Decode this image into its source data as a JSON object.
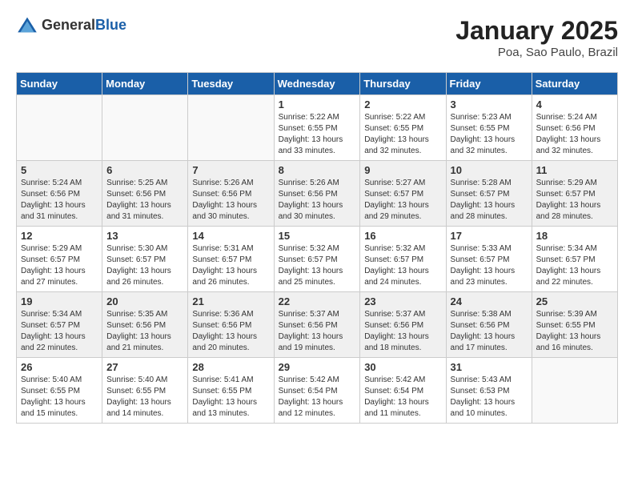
{
  "header": {
    "logo_general": "General",
    "logo_blue": "Blue",
    "month_title": "January 2025",
    "location": "Poa, Sao Paulo, Brazil"
  },
  "weekdays": [
    "Sunday",
    "Monday",
    "Tuesday",
    "Wednesday",
    "Thursday",
    "Friday",
    "Saturday"
  ],
  "weeks": [
    [
      {
        "day": "",
        "info": ""
      },
      {
        "day": "",
        "info": ""
      },
      {
        "day": "",
        "info": ""
      },
      {
        "day": "1",
        "info": "Sunrise: 5:22 AM\nSunset: 6:55 PM\nDaylight: 13 hours\nand 33 minutes."
      },
      {
        "day": "2",
        "info": "Sunrise: 5:22 AM\nSunset: 6:55 PM\nDaylight: 13 hours\nand 32 minutes."
      },
      {
        "day": "3",
        "info": "Sunrise: 5:23 AM\nSunset: 6:55 PM\nDaylight: 13 hours\nand 32 minutes."
      },
      {
        "day": "4",
        "info": "Sunrise: 5:24 AM\nSunset: 6:56 PM\nDaylight: 13 hours\nand 32 minutes."
      }
    ],
    [
      {
        "day": "5",
        "info": "Sunrise: 5:24 AM\nSunset: 6:56 PM\nDaylight: 13 hours\nand 31 minutes."
      },
      {
        "day": "6",
        "info": "Sunrise: 5:25 AM\nSunset: 6:56 PM\nDaylight: 13 hours\nand 31 minutes."
      },
      {
        "day": "7",
        "info": "Sunrise: 5:26 AM\nSunset: 6:56 PM\nDaylight: 13 hours\nand 30 minutes."
      },
      {
        "day": "8",
        "info": "Sunrise: 5:26 AM\nSunset: 6:56 PM\nDaylight: 13 hours\nand 30 minutes."
      },
      {
        "day": "9",
        "info": "Sunrise: 5:27 AM\nSunset: 6:57 PM\nDaylight: 13 hours\nand 29 minutes."
      },
      {
        "day": "10",
        "info": "Sunrise: 5:28 AM\nSunset: 6:57 PM\nDaylight: 13 hours\nand 28 minutes."
      },
      {
        "day": "11",
        "info": "Sunrise: 5:29 AM\nSunset: 6:57 PM\nDaylight: 13 hours\nand 28 minutes."
      }
    ],
    [
      {
        "day": "12",
        "info": "Sunrise: 5:29 AM\nSunset: 6:57 PM\nDaylight: 13 hours\nand 27 minutes."
      },
      {
        "day": "13",
        "info": "Sunrise: 5:30 AM\nSunset: 6:57 PM\nDaylight: 13 hours\nand 26 minutes."
      },
      {
        "day": "14",
        "info": "Sunrise: 5:31 AM\nSunset: 6:57 PM\nDaylight: 13 hours\nand 26 minutes."
      },
      {
        "day": "15",
        "info": "Sunrise: 5:32 AM\nSunset: 6:57 PM\nDaylight: 13 hours\nand 25 minutes."
      },
      {
        "day": "16",
        "info": "Sunrise: 5:32 AM\nSunset: 6:57 PM\nDaylight: 13 hours\nand 24 minutes."
      },
      {
        "day": "17",
        "info": "Sunrise: 5:33 AM\nSunset: 6:57 PM\nDaylight: 13 hours\nand 23 minutes."
      },
      {
        "day": "18",
        "info": "Sunrise: 5:34 AM\nSunset: 6:57 PM\nDaylight: 13 hours\nand 22 minutes."
      }
    ],
    [
      {
        "day": "19",
        "info": "Sunrise: 5:34 AM\nSunset: 6:57 PM\nDaylight: 13 hours\nand 22 minutes."
      },
      {
        "day": "20",
        "info": "Sunrise: 5:35 AM\nSunset: 6:56 PM\nDaylight: 13 hours\nand 21 minutes."
      },
      {
        "day": "21",
        "info": "Sunrise: 5:36 AM\nSunset: 6:56 PM\nDaylight: 13 hours\nand 20 minutes."
      },
      {
        "day": "22",
        "info": "Sunrise: 5:37 AM\nSunset: 6:56 PM\nDaylight: 13 hours\nand 19 minutes."
      },
      {
        "day": "23",
        "info": "Sunrise: 5:37 AM\nSunset: 6:56 PM\nDaylight: 13 hours\nand 18 minutes."
      },
      {
        "day": "24",
        "info": "Sunrise: 5:38 AM\nSunset: 6:56 PM\nDaylight: 13 hours\nand 17 minutes."
      },
      {
        "day": "25",
        "info": "Sunrise: 5:39 AM\nSunset: 6:55 PM\nDaylight: 13 hours\nand 16 minutes."
      }
    ],
    [
      {
        "day": "26",
        "info": "Sunrise: 5:40 AM\nSunset: 6:55 PM\nDaylight: 13 hours\nand 15 minutes."
      },
      {
        "day": "27",
        "info": "Sunrise: 5:40 AM\nSunset: 6:55 PM\nDaylight: 13 hours\nand 14 minutes."
      },
      {
        "day": "28",
        "info": "Sunrise: 5:41 AM\nSunset: 6:55 PM\nDaylight: 13 hours\nand 13 minutes."
      },
      {
        "day": "29",
        "info": "Sunrise: 5:42 AM\nSunset: 6:54 PM\nDaylight: 13 hours\nand 12 minutes."
      },
      {
        "day": "30",
        "info": "Sunrise: 5:42 AM\nSunset: 6:54 PM\nDaylight: 13 hours\nand 11 minutes."
      },
      {
        "day": "31",
        "info": "Sunrise: 5:43 AM\nSunset: 6:53 PM\nDaylight: 13 hours\nand 10 minutes."
      },
      {
        "day": "",
        "info": ""
      }
    ]
  ]
}
